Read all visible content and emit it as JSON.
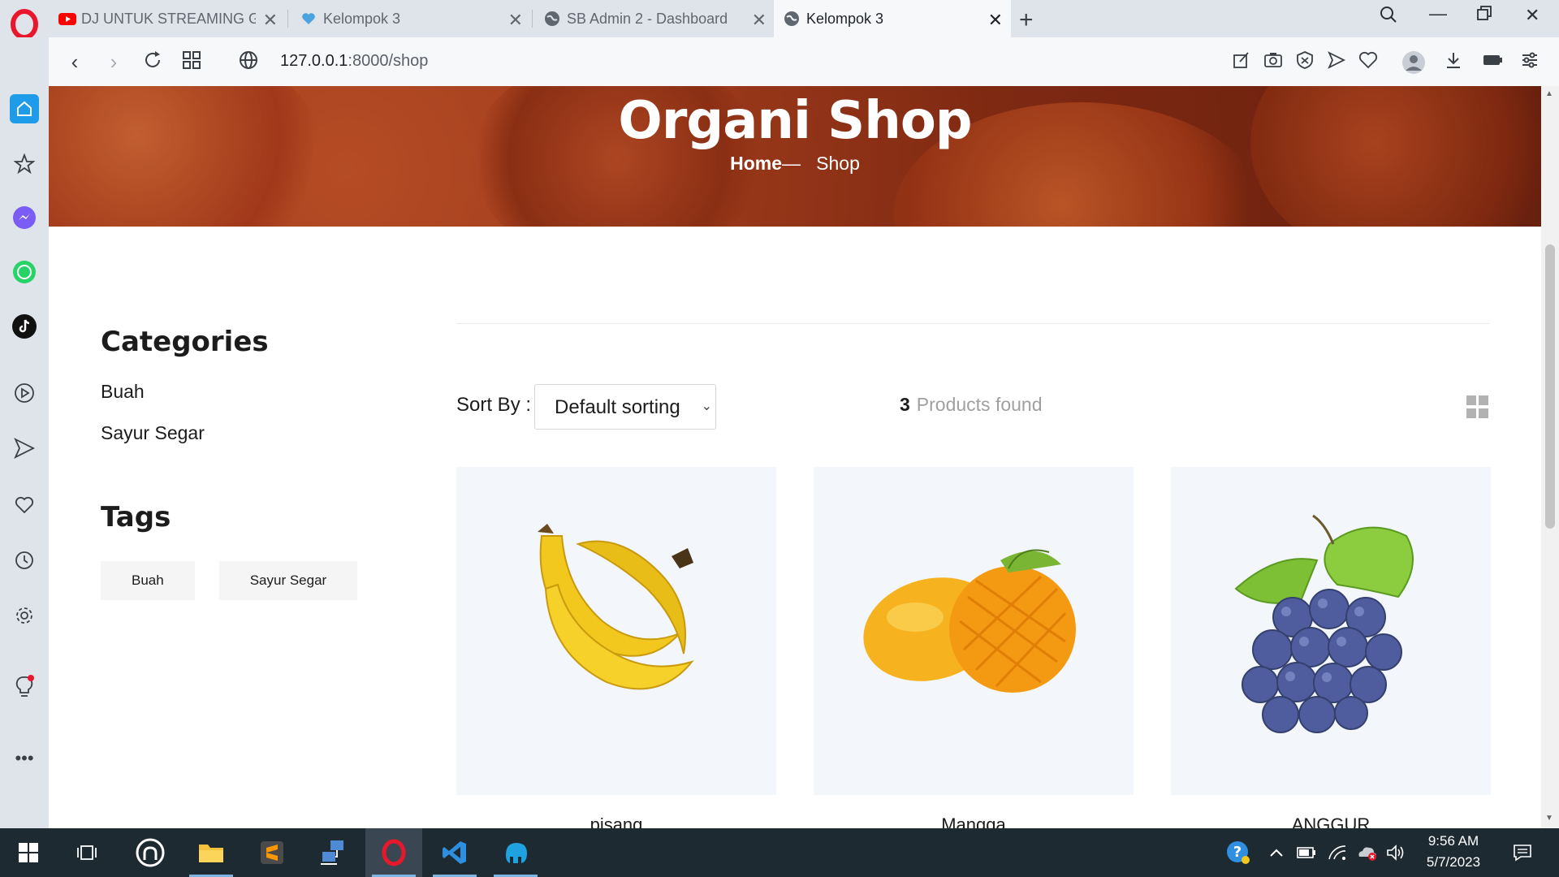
{
  "browser": {
    "tabs": [
      {
        "title": "DJ UNTUK STREAMING GA",
        "active": false
      },
      {
        "title": "Kelompok 3",
        "active": false
      },
      {
        "title": "SB Admin 2 - Dashboard",
        "active": false
      },
      {
        "title": "Kelompok 3",
        "active": true
      }
    ],
    "url_host": "127.0.0.1",
    "url_rest": ":8000/shop"
  },
  "hero": {
    "title": "Organi Shop",
    "breadcrumb_home": "Home",
    "breadcrumb_sep": "—",
    "breadcrumb_current": "Shop"
  },
  "sidebar": {
    "categories_title": "Categories",
    "categories": [
      "Buah",
      "Sayur Segar"
    ],
    "tags_title": "Tags",
    "tags": [
      "Buah",
      "Sayur Segar"
    ]
  },
  "shop": {
    "sort_label": "Sort By :",
    "sort_value": "Default sorting",
    "found_count": "3",
    "found_label": "Products found",
    "products": [
      {
        "name": "pisang",
        "image": "banana"
      },
      {
        "name": "Mangga",
        "image": "mango"
      },
      {
        "name": "ANGGUR",
        "image": "grapes"
      }
    ]
  },
  "taskbar": {
    "time": "9:56 AM",
    "date": "5/7/2023"
  },
  "colors": {
    "accent_opera": "#e8172c",
    "hero_bg": "#a03a1a",
    "taskbar_bg": "#1e2a32"
  }
}
